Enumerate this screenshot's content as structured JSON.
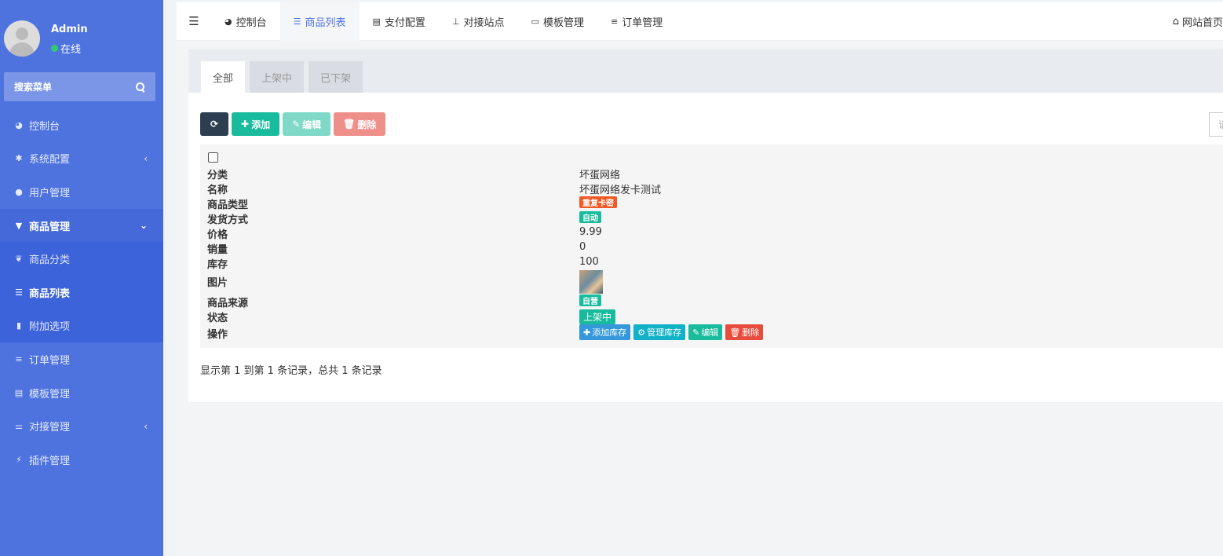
{
  "user": {
    "name": "Admin",
    "status": "在线"
  },
  "sidebar": {
    "search_placeholder": "搜索菜单",
    "items": [
      {
        "label": "控制台",
        "icon": "dashboard-icon"
      },
      {
        "label": "系统配置",
        "icon": "gear-icon",
        "caret": "‹"
      },
      {
        "label": "用户管理",
        "icon": "user-icon"
      },
      {
        "label": "商品管理",
        "icon": "cart-icon",
        "caret": "⌄"
      },
      {
        "label": "商品分类",
        "icon": "leaf-icon"
      },
      {
        "label": "商品列表",
        "icon": "list-icon"
      },
      {
        "label": "附加选项",
        "icon": "bookmark-icon"
      },
      {
        "label": "订单管理",
        "icon": "bars-icon"
      },
      {
        "label": "模板管理",
        "icon": "window-icon"
      },
      {
        "label": "对接管理",
        "icon": "sliders-icon",
        "caret": "‹"
      },
      {
        "label": "插件管理",
        "icon": "plug-icon"
      }
    ]
  },
  "topnav": {
    "tabs": [
      {
        "label": "控制台",
        "icon": "dashboard-icon"
      },
      {
        "label": "商品列表",
        "icon": "list-icon"
      },
      {
        "label": "支付配置",
        "icon": "server-icon"
      },
      {
        "label": "对接站点",
        "icon": "sitemap-icon"
      },
      {
        "label": "模板管理",
        "icon": "window-icon"
      },
      {
        "label": "订单管理",
        "icon": "bars-icon"
      }
    ],
    "right_link": "网站首页"
  },
  "status_tabs": [
    "全部",
    "上架中",
    "已下架"
  ],
  "toolbar": {
    "add_label": "添加",
    "edit_label": "编辑",
    "delete_label": "删除",
    "search_placeholder_fragment": "请"
  },
  "product": {
    "labels": {
      "category": "分类",
      "name": "名称",
      "type": "商品类型",
      "delivery": "发货方式",
      "price": "价格",
      "sales": "销量",
      "stock": "库存",
      "image": "图片",
      "source": "商品来源",
      "status": "状态",
      "actions": "操作"
    },
    "category": "坏蛋网络",
    "name": "坏蛋网络发卡测试",
    "type": "重复卡密",
    "delivery": "自动",
    "price": "9.99",
    "sales": "0",
    "stock": "100",
    "source": "自营",
    "status": "上架中",
    "actions": {
      "add_stock": "添加库存",
      "manage_stock": "管理库存",
      "edit": "编辑",
      "delete": "删除"
    }
  },
  "pagination_text": "显示第 1 到第 1 条记录，总共 1 条记录",
  "colors": {
    "sidebar": "#4e73df",
    "success": "#18bc9c",
    "danger": "#e74c3c",
    "dark": "#2c3e50"
  }
}
